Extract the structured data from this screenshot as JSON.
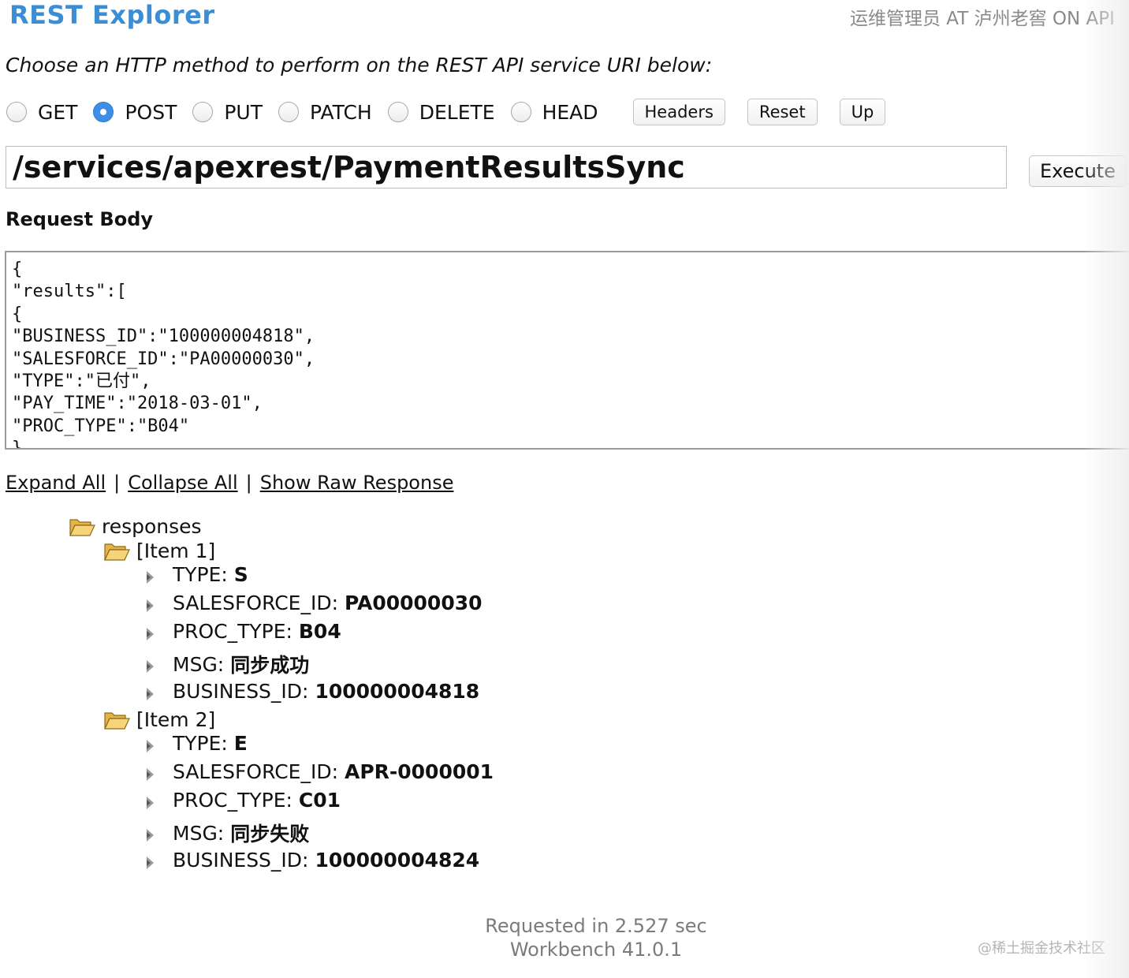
{
  "header": {
    "app_title": "REST Explorer",
    "user_info": "运维管理员 AT 泸州老窖 ON API"
  },
  "instruction": "Choose an HTTP method to perform on the REST API service URI below:",
  "methods": [
    {
      "label": "GET",
      "checked": false
    },
    {
      "label": "POST",
      "checked": true
    },
    {
      "label": "PUT",
      "checked": false
    },
    {
      "label": "PATCH",
      "checked": false
    },
    {
      "label": "DELETE",
      "checked": false
    },
    {
      "label": "HEAD",
      "checked": false
    }
  ],
  "buttons": {
    "headers": "Headers",
    "reset": "Reset",
    "up": "Up",
    "execute": "Execute"
  },
  "uri": "/services/apexrest/PaymentResultsSync",
  "request_body": {
    "title": "Request Body",
    "lines": [
      "{",
      "\"results\":[",
      "{",
      "\"BUSINESS_ID\":\"100000004818\",",
      "\"SALESFORCE_ID\":\"PA00000030\",",
      "\"TYPE\":\"已付\",",
      "\"PAY_TIME\":\"2018-03-01\",",
      "\"PROC_TYPE\":\"B04\"",
      "}"
    ]
  },
  "links": {
    "expand_all": "Expand All",
    "collapse_all": "Collapse All",
    "show_raw": "Show Raw Response",
    "separator": "|"
  },
  "tree": {
    "root": "responses",
    "items": [
      {
        "label": "[Item 1]",
        "fields": [
          {
            "key": "TYPE:",
            "value": "S"
          },
          {
            "key": "SALESFORCE_ID:",
            "value": "PA00000030"
          },
          {
            "key": "PROC_TYPE:",
            "value": "B04"
          },
          {
            "key": "MSG:",
            "value": "同步成功"
          },
          {
            "key": "BUSINESS_ID:",
            "value": "100000004818"
          }
        ]
      },
      {
        "label": "[Item 2]",
        "fields": [
          {
            "key": "TYPE:",
            "value": "E"
          },
          {
            "key": "SALESFORCE_ID:",
            "value": "APR-0000001"
          },
          {
            "key": "PROC_TYPE:",
            "value": "C01"
          },
          {
            "key": "MSG:",
            "value": "同步失败"
          },
          {
            "key": "BUSINESS_ID:",
            "value": "100000004824"
          }
        ]
      }
    ]
  },
  "footer": {
    "requested": "Requested in 2.527 sec",
    "version": "Workbench 41.0.1"
  },
  "watermark": "@稀土掘金技术社区",
  "colors": {
    "title_blue": "#3b8ed6",
    "radio_selected": "#3c8ee6",
    "muted_text": "#7b7b7b"
  },
  "icons": {
    "folder": "open-folder-icon",
    "leaf": "tree-leaf-icon"
  }
}
